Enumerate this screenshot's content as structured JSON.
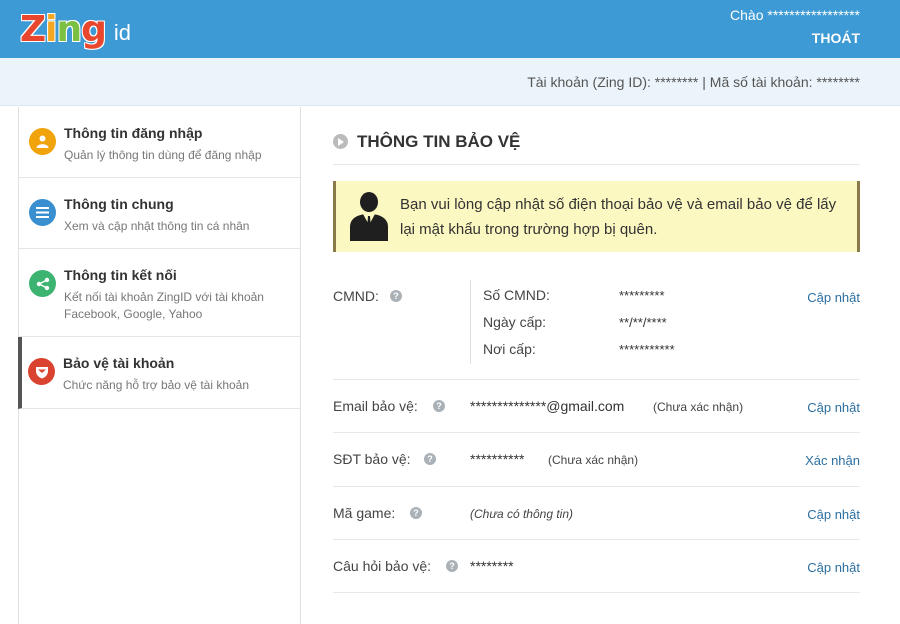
{
  "header": {
    "logo_letters": [
      "Z",
      "i",
      "n",
      "g"
    ],
    "logo_colors": [
      "#e8472d",
      "#f5a623",
      "#7bc043",
      "#2f8fd8"
    ],
    "logo_suffix": "id",
    "greeting": "Chào *****************",
    "logout": "THOÁT"
  },
  "account_bar": {
    "text": "Tài khoản (Zing ID): ******** | Mã số tài khoản: ********"
  },
  "sidebar": {
    "items": [
      {
        "title": "Thông tin đăng nhập",
        "subtitle": "Quản lý thông tin dùng để đăng nhập",
        "icon": "user-icon",
        "color": "#f0a30a"
      },
      {
        "title": "Thông tin chung",
        "subtitle": "Xem và cập nhật thông tin cá nhân",
        "icon": "list-icon",
        "color": "#3a8fd0"
      },
      {
        "title": "Thông tin kết nối",
        "subtitle": "Kết nối tài khoản ZingID với tài khoản Facebook, Google, Yahoo",
        "icon": "share-icon",
        "color": "#3cb371"
      },
      {
        "title": "Bảo vệ tài khoản",
        "subtitle": "Chức năng hỗ trợ bảo vệ tài khoản",
        "icon": "shield-icon",
        "color": "#d9432f",
        "active": true
      }
    ]
  },
  "main": {
    "section_title": "THÔNG TIN BẢO VỆ",
    "notice": "Bạn vui lòng cập nhật số điện thoại bảo vệ và email bảo vệ để lấy lại mật khẩu trong trường hợp bị quên.",
    "cmnd": {
      "label": "CMND:",
      "fields": [
        {
          "label": "Số CMND:",
          "value": "*********"
        },
        {
          "label": "Ngày cấp:",
          "value": "**/**/****"
        },
        {
          "label": "Nơi cấp:",
          "value": "***********"
        }
      ],
      "action": "Cập nhật"
    },
    "email": {
      "label": "Email bảo vệ:",
      "value": "**************@gmail.com",
      "note": "(Chưa xác nhận)",
      "action": "Cập nhật"
    },
    "phone": {
      "label": "SĐT bảo vệ:",
      "value": "**********",
      "note": "(Chưa xác nhận)",
      "action": "Xác nhận"
    },
    "game": {
      "label": "Mã game:",
      "note": "(Chưa có thông tin)",
      "action": "Cập nhật"
    },
    "question": {
      "label": "Câu hỏi bảo vệ:",
      "value": "********",
      "action": "Cập nhật"
    },
    "help_glyph": "?"
  }
}
